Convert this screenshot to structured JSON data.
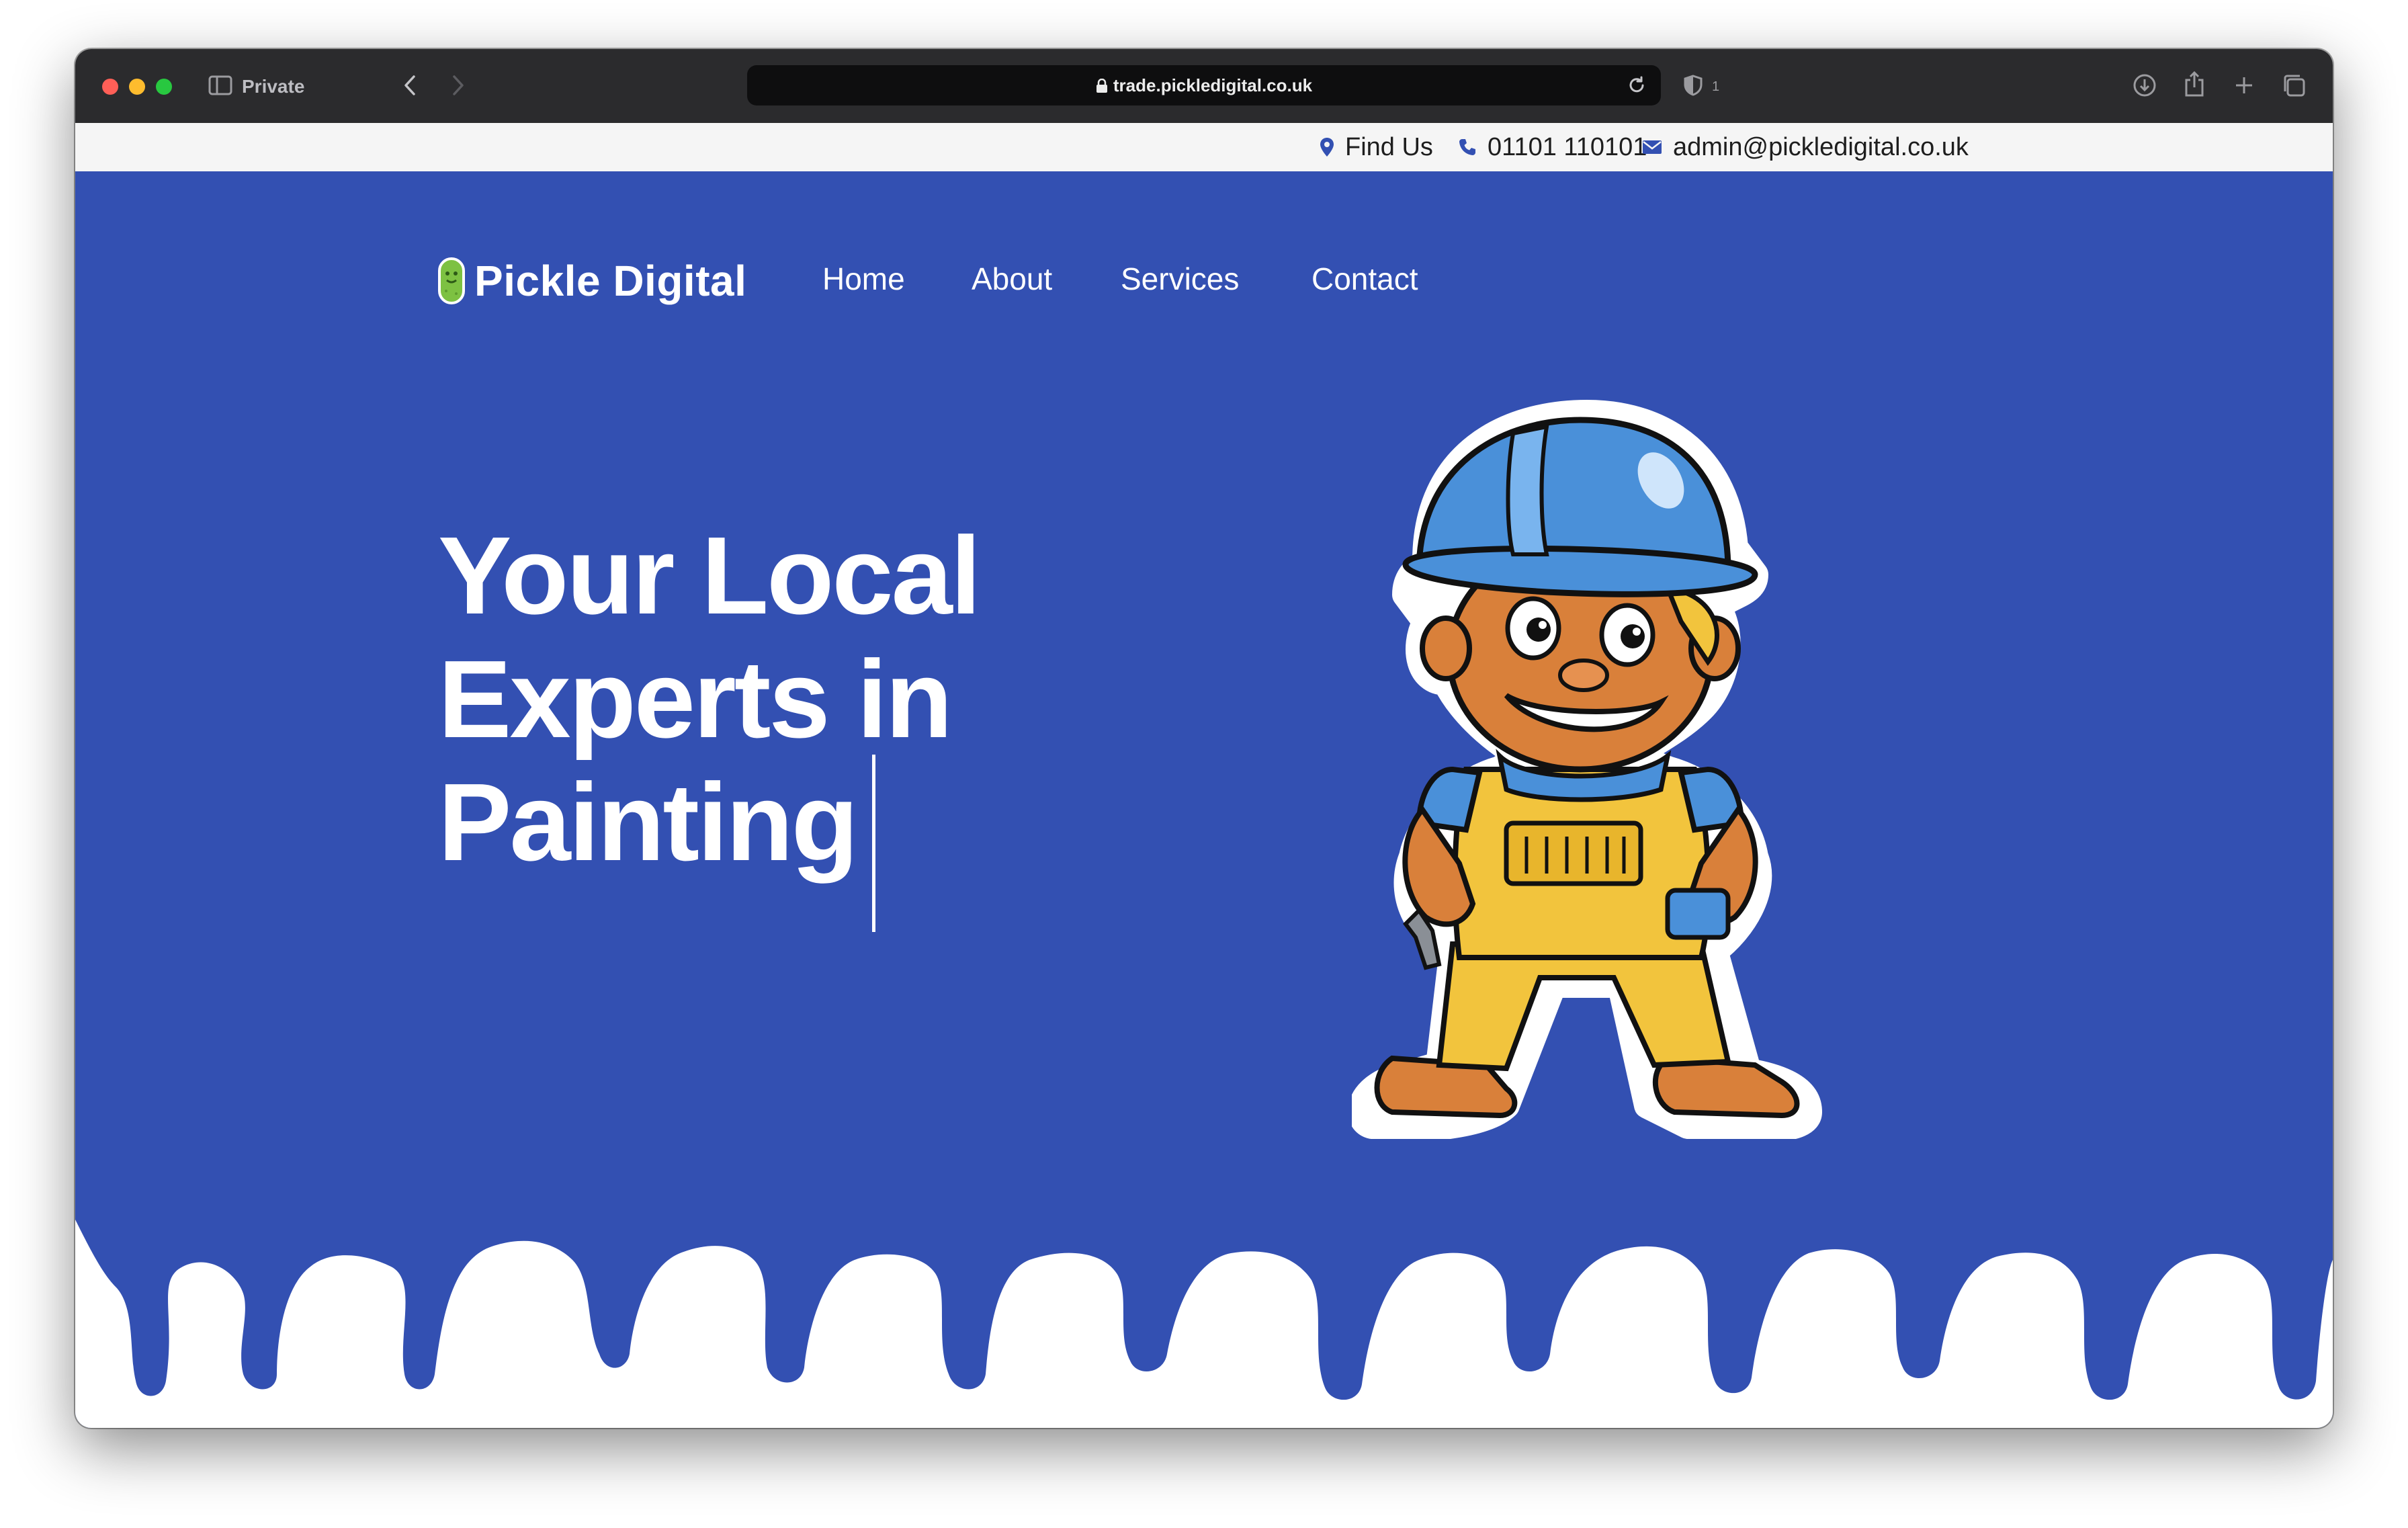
{
  "browser": {
    "private_label": "Private",
    "url": "trade.pickledigital.co.uk",
    "shield_count": "1"
  },
  "topbar": {
    "find_us": "Find Us",
    "phone": "01101 110101",
    "email": "admin@pickledigital.co.uk"
  },
  "site": {
    "logo_text": "Pickle Digital",
    "nav": {
      "home": "Home",
      "about": "About",
      "services": "Services",
      "contact": "Contact"
    }
  },
  "hero": {
    "headline_line1": "Your Local",
    "headline_line2": "Experts in",
    "headline_line3": "Painting"
  },
  "colors": {
    "hero_blue": "#3350b2",
    "browser_chrome": "#2b2b2d",
    "topbar_bg": "#f5f5f5",
    "accent_green": "#7dc142"
  },
  "icons": [
    "sidebar-icon",
    "back-icon",
    "forward-icon",
    "lock-icon",
    "reload-icon",
    "shield-icon",
    "download-icon",
    "share-icon",
    "new-tab-icon",
    "tabs-overview-icon",
    "map-pin-icon",
    "phone-icon",
    "envelope-icon"
  ]
}
